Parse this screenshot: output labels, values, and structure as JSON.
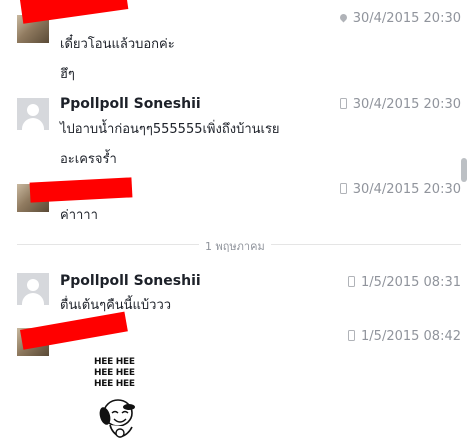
{
  "messages": [
    {
      "sender": "",
      "timestamp": "30/4/2015 20:30",
      "lines": [
        "เดี๋ยวโอนแล้วบอกค่ะ",
        "ฮึๆ"
      ]
    },
    {
      "sender": "Ppollpoll Soneshii",
      "timestamp": "30/4/2015 20:30",
      "lines": [
        "ไปอาบน้ำก่อนๆๆ555555เพิ่งถึงบ้านเรย",
        "อะเครจร้ำ"
      ]
    },
    {
      "sender": "",
      "timestamp": "30/4/2015 20:30",
      "lines": [
        "ค่าาาา"
      ]
    },
    {
      "sender": "Ppollpoll Soneshii",
      "timestamp": "1/5/2015 08:31",
      "lines": [
        "ตื่นเต้นๆคืนนี้แบ้ววว"
      ]
    },
    {
      "sender": "",
      "timestamp": "1/5/2015 08:42",
      "sticker_lines": [
        "HEE HEE",
        "HEE HEE",
        "HEE HEE"
      ]
    }
  ],
  "date_divider": "1 พฤษภาคม",
  "icons": {
    "location": "location-pin-icon",
    "mobile": "mobile-phone-icon"
  },
  "colors": {
    "redaction": "#ff0000",
    "meta_text": "#90949c",
    "divider": "#e5e5e5"
  }
}
